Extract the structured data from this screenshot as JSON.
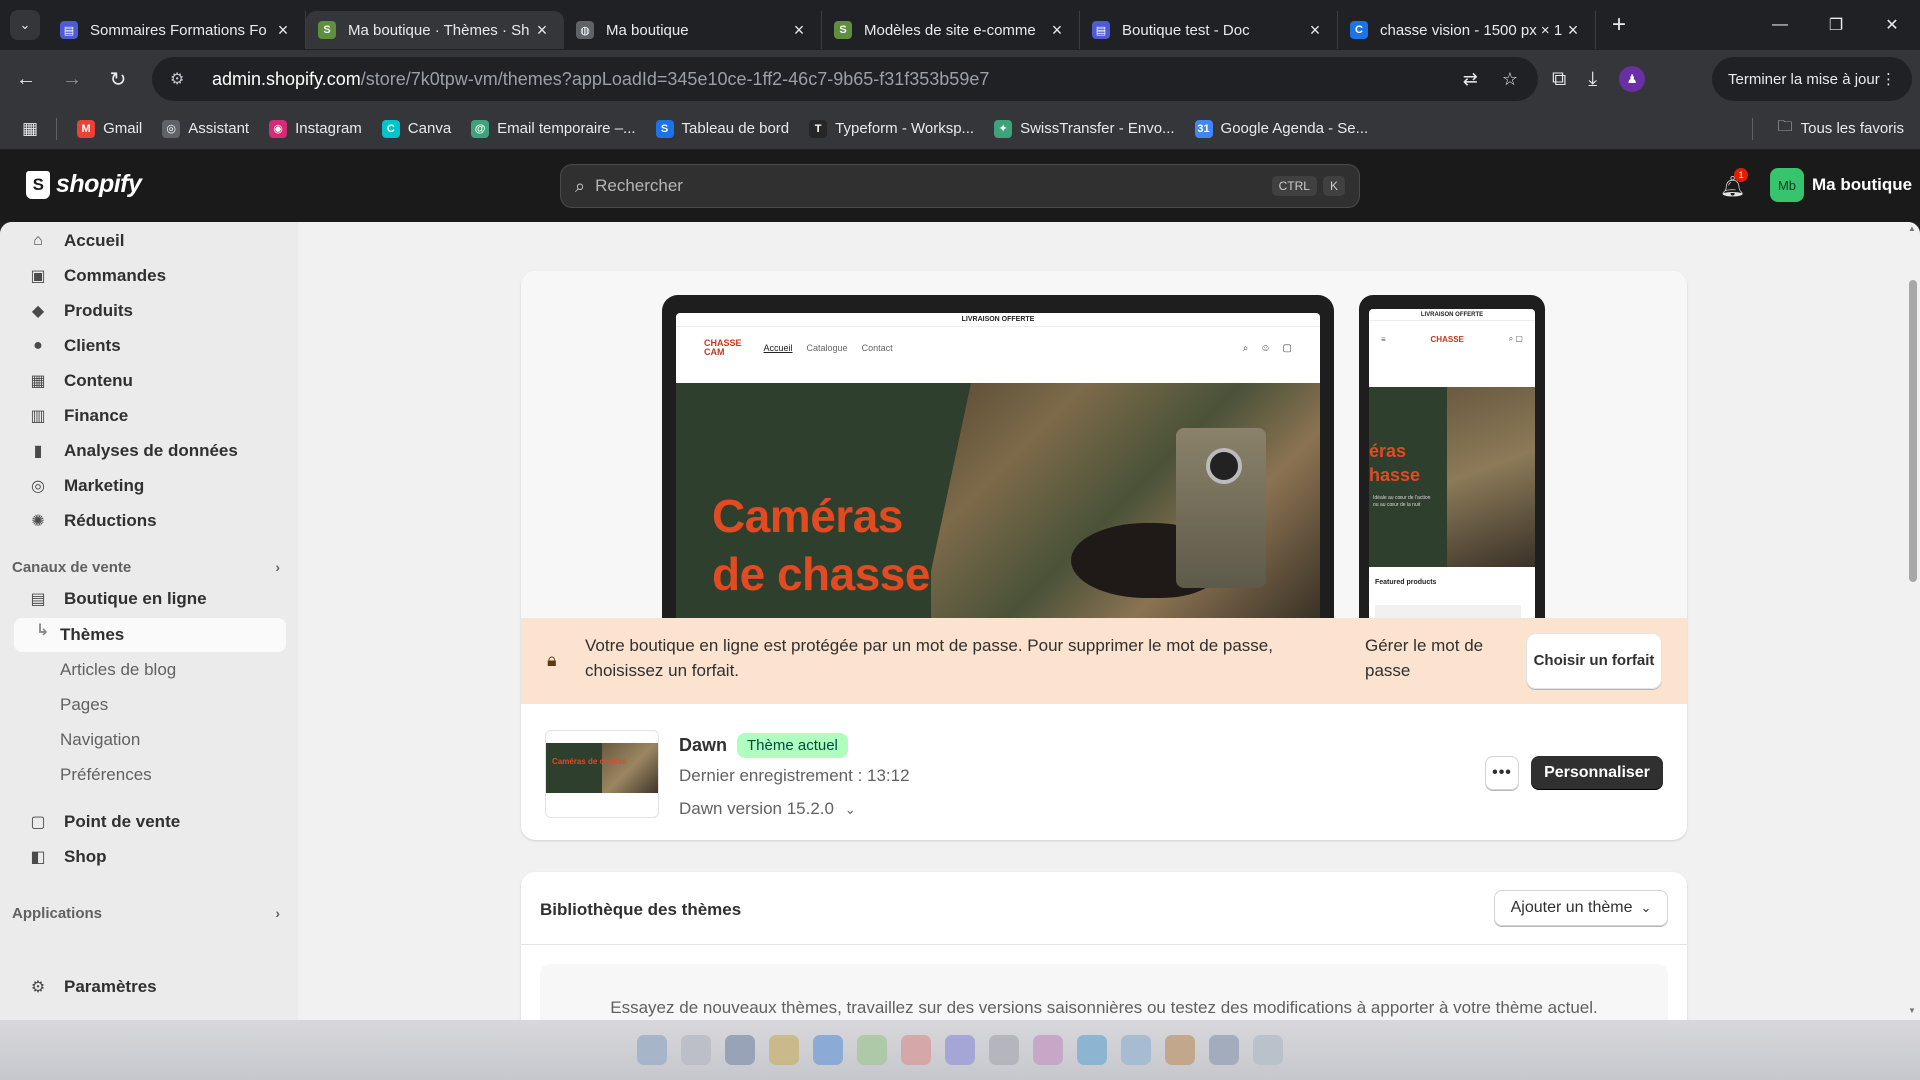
{
  "browser": {
    "tabs": [
      {
        "title": "Sommaires Formations Fo",
        "color": "#4d5bd6",
        "glyph": "▤"
      },
      {
        "title": "Ma boutique · Thèmes · Sh",
        "color": "#5e8e3e",
        "glyph": "S",
        "active": true
      },
      {
        "title": "Ma boutique",
        "color": "#5f6368",
        "glyph": "◍"
      },
      {
        "title": "Modèles de site e-comme",
        "color": "#5e8e3e",
        "glyph": "S"
      },
      {
        "title": "Boutique test - Doc",
        "color": "#4d5bd6",
        "glyph": "▤"
      },
      {
        "title": "chasse vision - 1500 px × 1",
        "color": "#1a73e8",
        "glyph": "C"
      }
    ],
    "url_host": "admin.shopify.com",
    "url_path": "/store/7k0tpw-vm/themes?appLoadId=345e10ce-1ff2-46c7-9b65-f31f353b59e7",
    "update_label": "Terminer la mise à jour",
    "bookmarks": [
      {
        "label": "Gmail",
        "color": "#ea4335",
        "glyph": "M"
      },
      {
        "label": "Assistant",
        "color": "#5f6368",
        "glyph": "◎"
      },
      {
        "label": "Instagram",
        "color": "#d62976",
        "glyph": "◉"
      },
      {
        "label": "Canva",
        "color": "#00c4cc",
        "glyph": "C"
      },
      {
        "label": "Email temporaire –...",
        "color": "#3ea37a",
        "glyph": "@"
      },
      {
        "label": "Tableau de bord",
        "color": "#1a73e8",
        "glyph": "S"
      },
      {
        "label": "Typeform - Worksp...",
        "color": "#262627",
        "glyph": "T"
      },
      {
        "label": "SwissTransfer - Envo...",
        "color": "#3ea37a",
        "glyph": "✦"
      },
      {
        "label": "Google Agenda - Se...",
        "color": "#4285f4",
        "glyph": "31"
      }
    ],
    "all_bookmarks": "Tous les favoris"
  },
  "shopify": {
    "logo": "shopify",
    "search_placeholder": "Rechercher",
    "kbd1": "CTRL",
    "kbd2": "K",
    "notif_count": "1",
    "store_initials": "Mb",
    "store_name": "Ma boutique"
  },
  "sidebar": {
    "main": [
      {
        "label": "Accueil",
        "icon": "home-icon",
        "glyph": "⌂"
      },
      {
        "label": "Commandes",
        "icon": "inbox-icon",
        "glyph": "▣"
      },
      {
        "label": "Produits",
        "icon": "tag-icon",
        "glyph": "◆"
      },
      {
        "label": "Clients",
        "icon": "person-icon",
        "glyph": "●"
      },
      {
        "label": "Contenu",
        "icon": "image-icon",
        "glyph": "▦"
      },
      {
        "label": "Finance",
        "icon": "bank-icon",
        "glyph": "▥"
      },
      {
        "label": "Analyses de données",
        "icon": "chart-icon",
        "glyph": "▮"
      },
      {
        "label": "Marketing",
        "icon": "target-icon",
        "glyph": "◎"
      },
      {
        "label": "Réductions",
        "icon": "discount-icon",
        "glyph": "✺"
      }
    ],
    "sales_channels_heading": "Canaux de vente",
    "online_store": "Boutique en ligne",
    "online_sub": [
      "Thèmes",
      "Articles de blog",
      "Pages",
      "Navigation",
      "Préférences"
    ],
    "pos": "Point de vente",
    "shop": "Shop",
    "apps_heading": "Applications",
    "settings": "Paramètres"
  },
  "preview": {
    "announcement": "LIVRAISON OFFERTE",
    "brand_top": "CHASSE",
    "brand_bottom": "CAM",
    "nav_links": [
      "Accueil",
      "Catalogue",
      "Contact"
    ],
    "hero_line1": "Caméras",
    "hero_line2": "de chasse",
    "mobile_hero_line1": "éras",
    "mobile_hero_line2": "hasse",
    "mobile_sub": "Idéale au cœur de l'action ou au cœur de la nuit",
    "featured": "Featured products"
  },
  "banner": {
    "message": "Votre boutique en ligne est protégée par un mot de passe. Pour supprimer le mot de passe, choisissez un forfait.",
    "manage": "Gérer le mot de passe",
    "choose": "Choisir un forfait"
  },
  "current_theme": {
    "thumb_text": "Caméras de chasse",
    "name": "Dawn",
    "badge": "Thème actuel",
    "saved": "Dernier enregistrement : 13:12",
    "version": "Dawn version 15.2.0",
    "customize": "Personnaliser"
  },
  "library": {
    "heading": "Bibliothèque des thèmes",
    "add": "Ajouter un thème",
    "body": "Essayez de nouveaux thèmes, travaillez sur des versions saisonnières ou testez des modifications à apporter à votre thème actuel."
  }
}
